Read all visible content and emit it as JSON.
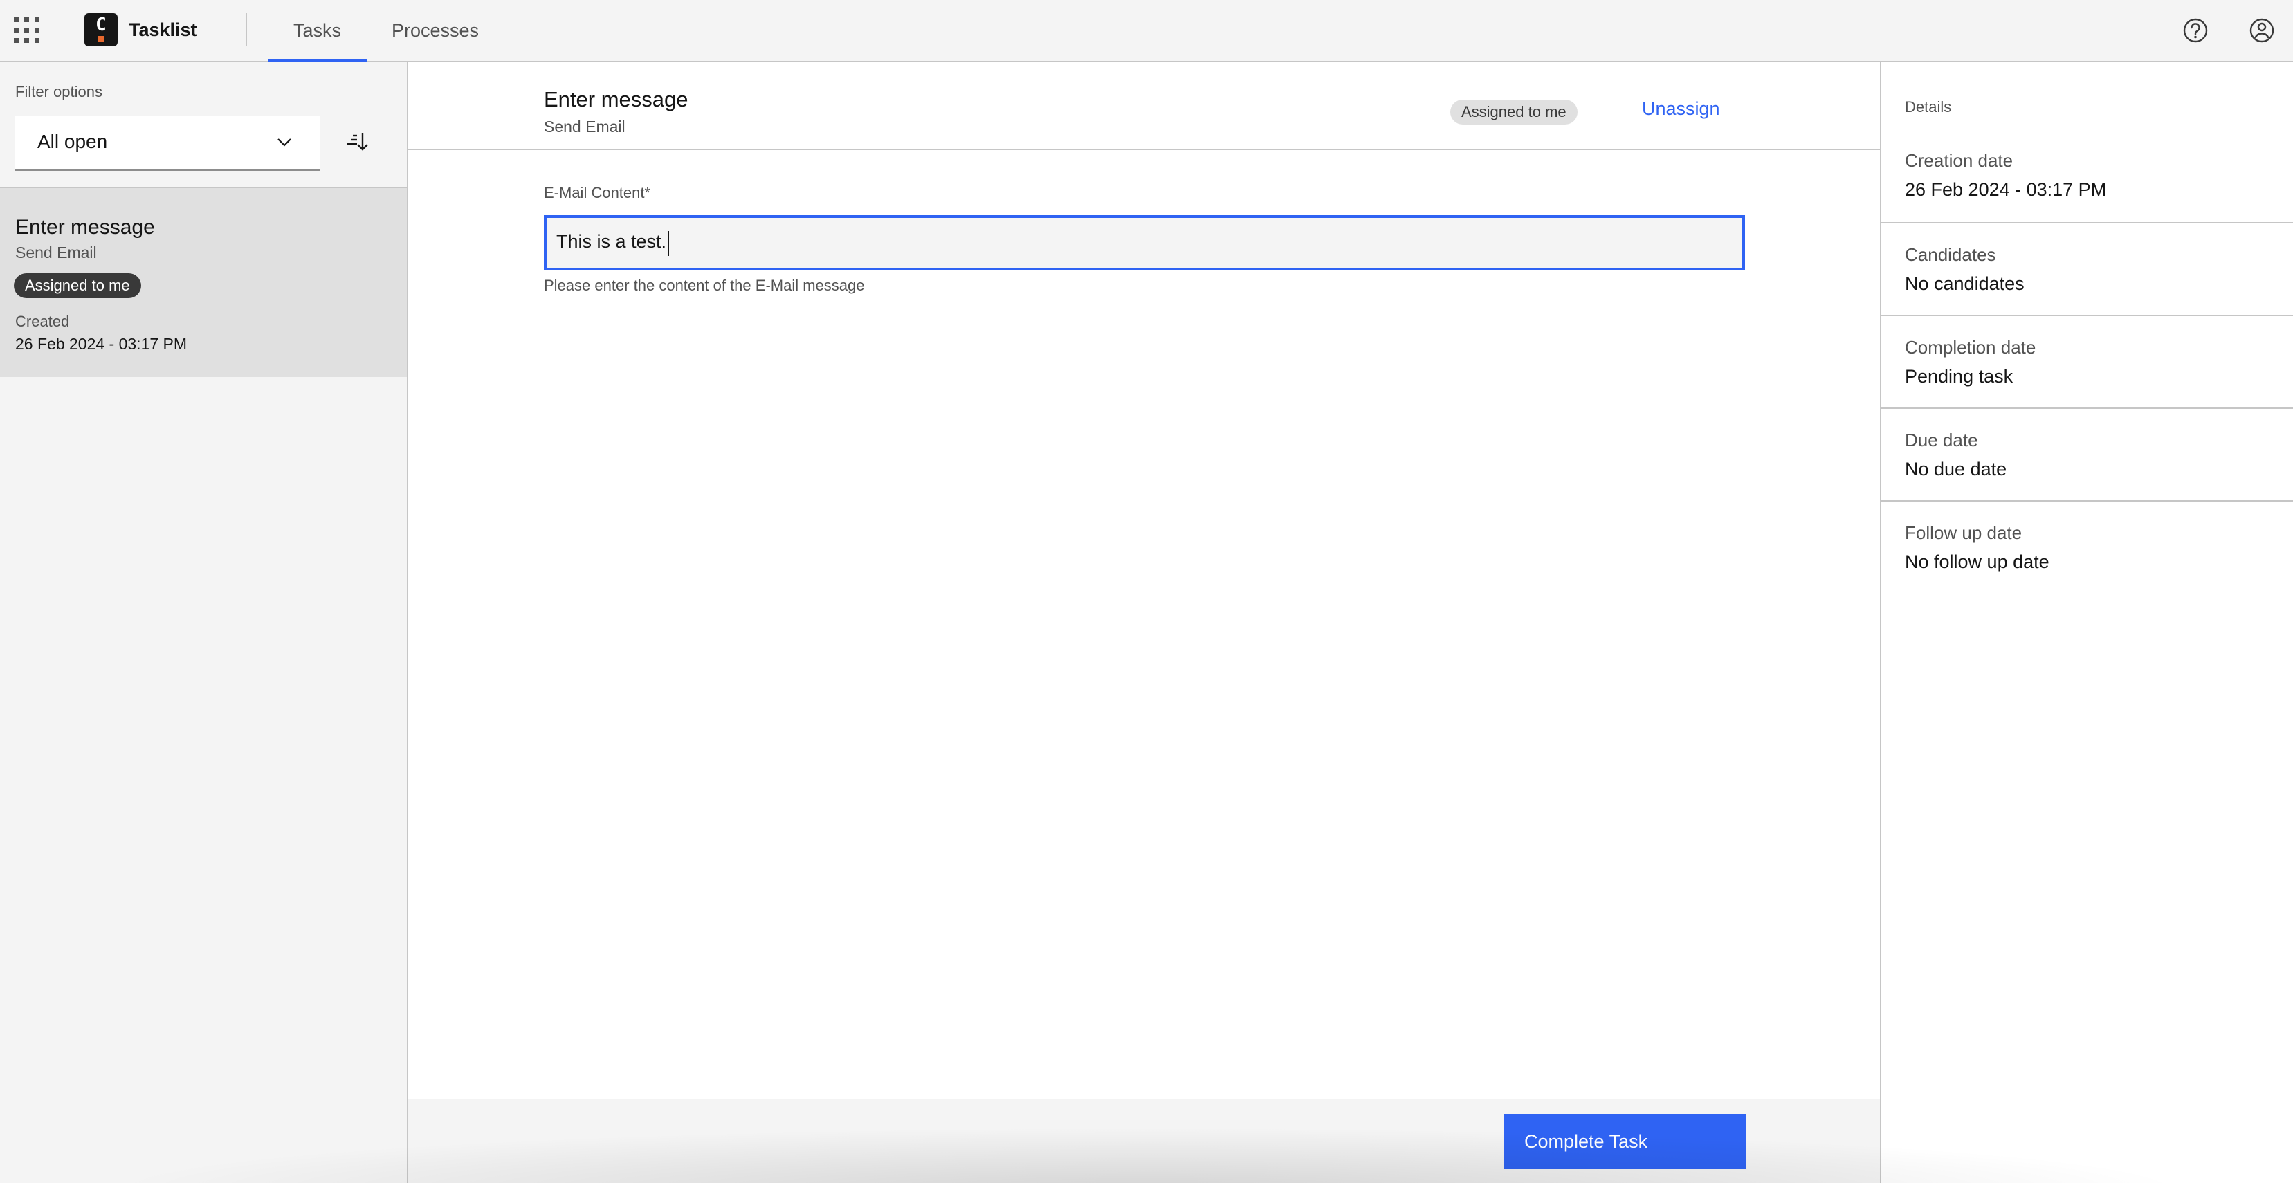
{
  "header": {
    "app_name": "Tasklist",
    "tabs": [
      {
        "label": "Tasks",
        "active": true
      },
      {
        "label": "Processes",
        "active": false
      }
    ],
    "icons": [
      "app-switcher-icon",
      "help-icon",
      "user-icon"
    ]
  },
  "filter": {
    "label": "Filter options",
    "selected": "All open"
  },
  "task_list": [
    {
      "title": "Enter message",
      "process": "Send Email",
      "badge": "Assigned to me",
      "created_label": "Created",
      "created_value": "26 Feb 2024 - 03:17 PM"
    }
  ],
  "task": {
    "title": "Enter message",
    "process": "Send Email",
    "assignment_tag": "Assigned to me",
    "unassign_label": "Unassign",
    "form": {
      "field_label": "E-Mail Content*",
      "field_value": "This is a test.",
      "helper_text": "Please enter the content of the E-Mail message"
    },
    "complete_label": "Complete Task"
  },
  "details": {
    "heading": "Details",
    "items": [
      {
        "label": "Creation date",
        "value": "26 Feb 2024 - 03:17 PM"
      },
      {
        "label": "Candidates",
        "value": "No candidates"
      },
      {
        "label": "Completion date",
        "value": "Pending task"
      },
      {
        "label": "Due date",
        "value": "No due date"
      },
      {
        "label": "Follow up date",
        "value": "No follow up date"
      }
    ]
  },
  "colors": {
    "accent": "#2f63f3",
    "logo_bg": "#161616",
    "logo_mark": "#e8692e",
    "selected_card": "#e0e0e0"
  }
}
